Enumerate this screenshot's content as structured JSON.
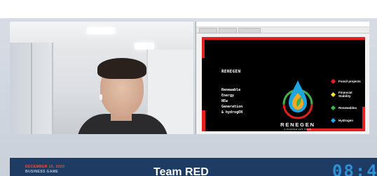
{
  "slide": {
    "heading": "RENEGEN",
    "acronym_lines": [
      "Renewable",
      "Energy",
      "NEw",
      "Generation",
      "& hydrogEN"
    ],
    "logo_title": "RENEGEN",
    "logo_tagline": "A CHANGE HAS COME",
    "bullets": [
      {
        "label": "Fossil projects",
        "color": "#e3201b"
      },
      {
        "label": "Financial Stability",
        "color": "#f5e623"
      },
      {
        "label": "Renewables",
        "color": "#3bb34a"
      },
      {
        "label": "Hydrogen",
        "color": "#2aa8e0"
      }
    ],
    "accent_color": "#e3201b"
  },
  "lower_band": {
    "date": "DECEMBER 10, 2020",
    "event": "BUSINESS GAME",
    "team": "Team RED",
    "clock": "08:4"
  },
  "icons": {
    "logo": "water-drop-leaf-logo-icon"
  }
}
